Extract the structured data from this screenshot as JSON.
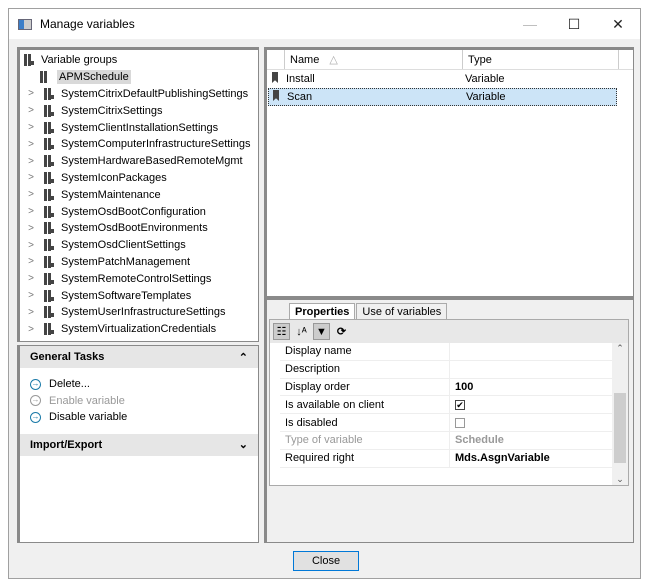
{
  "window": {
    "title": "Manage variables",
    "minimize": "—",
    "maximize": "☐",
    "close": "✕"
  },
  "tree": {
    "root": "Variable groups",
    "selected": "APMSchedule",
    "items": [
      "SystemCitrixDefaultPublishingSettings",
      "SystemCitrixSettings",
      "SystemClientInstallationSettings",
      "SystemComputerInfrastructureSettings",
      "SystemHardwareBasedRemoteMgmt",
      "SystemIconPackages",
      "SystemMaintenance",
      "SystemOsdBootConfiguration",
      "SystemOsdBootEnvironments",
      "SystemOsdClientSettings",
      "SystemPatchManagement",
      "SystemRemoteControlSettings",
      "SystemSoftwareTemplates",
      "SystemUserInfrastructureSettings",
      "SystemVirtualizationCredentials"
    ]
  },
  "tasks": {
    "general": "General Tasks",
    "items": [
      {
        "label": "Delete...",
        "enabled": true
      },
      {
        "label": "Enable variable",
        "enabled": false
      },
      {
        "label": "Disable variable",
        "enabled": true
      }
    ],
    "import_export": "Import/Export"
  },
  "list": {
    "columns": [
      "Name",
      "Type"
    ],
    "rows": [
      {
        "name": "Install",
        "type": "Variable"
      },
      {
        "name": "Scan",
        "type": "Variable"
      }
    ]
  },
  "props": {
    "tabs": [
      "Properties",
      "Use of variables"
    ],
    "rows": [
      {
        "key": "Display name",
        "value": ""
      },
      {
        "key": "Description",
        "value": ""
      },
      {
        "key": "Display order",
        "value": "100"
      },
      {
        "key": "Is available on client",
        "checked": true
      },
      {
        "key": "Is disabled",
        "checked": false
      },
      {
        "key": "Type of variable",
        "value": "Schedule"
      },
      {
        "key": "Required right",
        "value": "Mds.AsgnVariable"
      }
    ]
  },
  "close_button": "Close"
}
